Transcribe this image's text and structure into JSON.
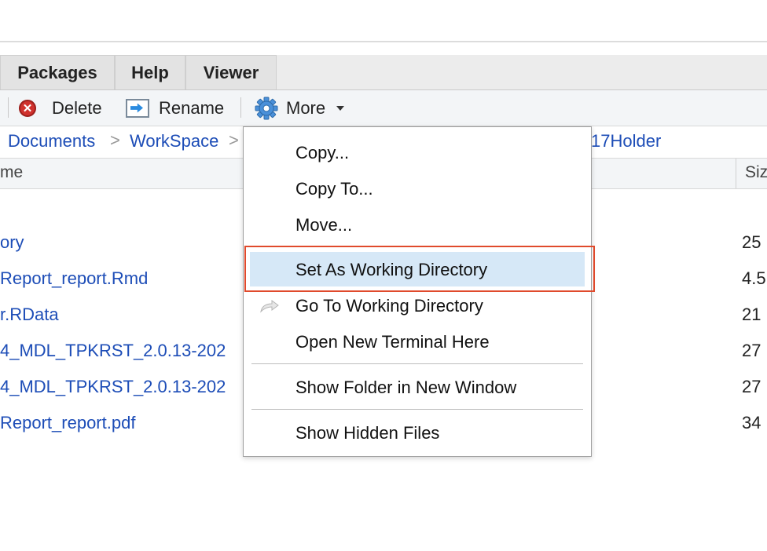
{
  "tabs": [
    {
      "label": "Packages"
    },
    {
      "label": "Help"
    },
    {
      "label": "Viewer"
    }
  ],
  "toolbar": {
    "delete_label": "Delete",
    "rename_label": "Rename",
    "more_label": "More",
    "delete_icon_text": "✕",
    "icons": {
      "delete": "delete-icon",
      "rename": "rename-icon",
      "more": "gear-icon",
      "dropdown": "caret-down-icon"
    }
  },
  "breadcrumb": {
    "items": [
      "Documents",
      "WorkSpace",
      "17Holder"
    ],
    "separator": ">"
  },
  "columns": {
    "name": "me",
    "size": "Siz"
  },
  "files": [
    {
      "name": "ory",
      "size": "25"
    },
    {
      "name": "Report_report.Rmd",
      "size": "4.5"
    },
    {
      "name": "r.RData",
      "size": "21"
    },
    {
      "name": "4_MDL_TPKRST_2.0.13-202",
      "size": "27"
    },
    {
      "name": "4_MDL_TPKRST_2.0.13-202",
      "size": "27"
    },
    {
      "name": "Report_report.pdf",
      "size": "34"
    }
  ],
  "menu": {
    "items": [
      {
        "label": "Copy..."
      },
      {
        "label": "Copy To..."
      },
      {
        "label": "Move..."
      },
      {
        "label": "Set As Working Directory",
        "highlighted": true
      },
      {
        "label": "Go To Working Directory",
        "icon": "goto-arrow-icon"
      },
      {
        "label": "Open New Terminal Here"
      },
      {
        "label": "Show Folder in New Window"
      },
      {
        "label": "Show Hidden Files"
      }
    ],
    "highlight_color": "#d6e8f7",
    "annotation_color": "#e04a2c"
  },
  "colors": {
    "link": "#1d4db7",
    "toolbar_bg": "#f3f5f7",
    "tab_bg": "#e3e3e3"
  }
}
